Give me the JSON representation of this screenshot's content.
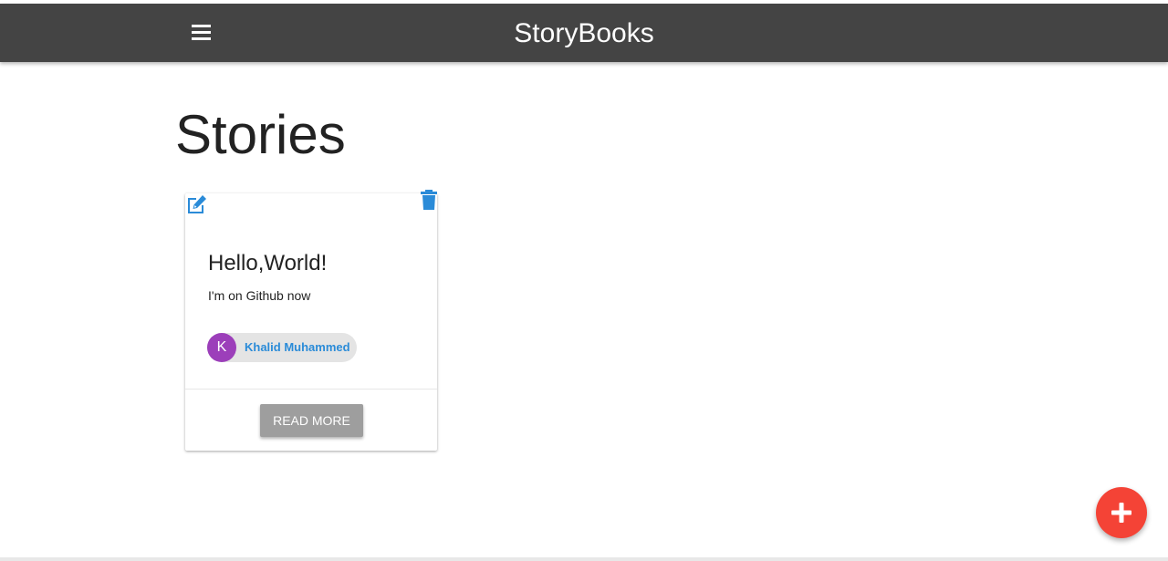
{
  "app": {
    "brand": "StoryBooks"
  },
  "navbar": {
    "menu_icon": "hamburger-menu-icon"
  },
  "page": {
    "title": "Stories"
  },
  "stories": [
    {
      "title": "Hello,World!",
      "body": "I'm on Github now",
      "author_initial": "K",
      "author_name": "Khalid Muhammed",
      "read_more_label": "READ MORE",
      "edit_icon": "edit-icon",
      "delete_icon": "trash-icon"
    }
  ],
  "fab": {
    "icon": "plus-icon"
  },
  "colors": {
    "navbar": "#444444",
    "accent_blue": "#2a8bd8",
    "avatar_purple": "#9c3fba",
    "fab_red": "#f44336",
    "button_grey": "#9e9e9e"
  }
}
